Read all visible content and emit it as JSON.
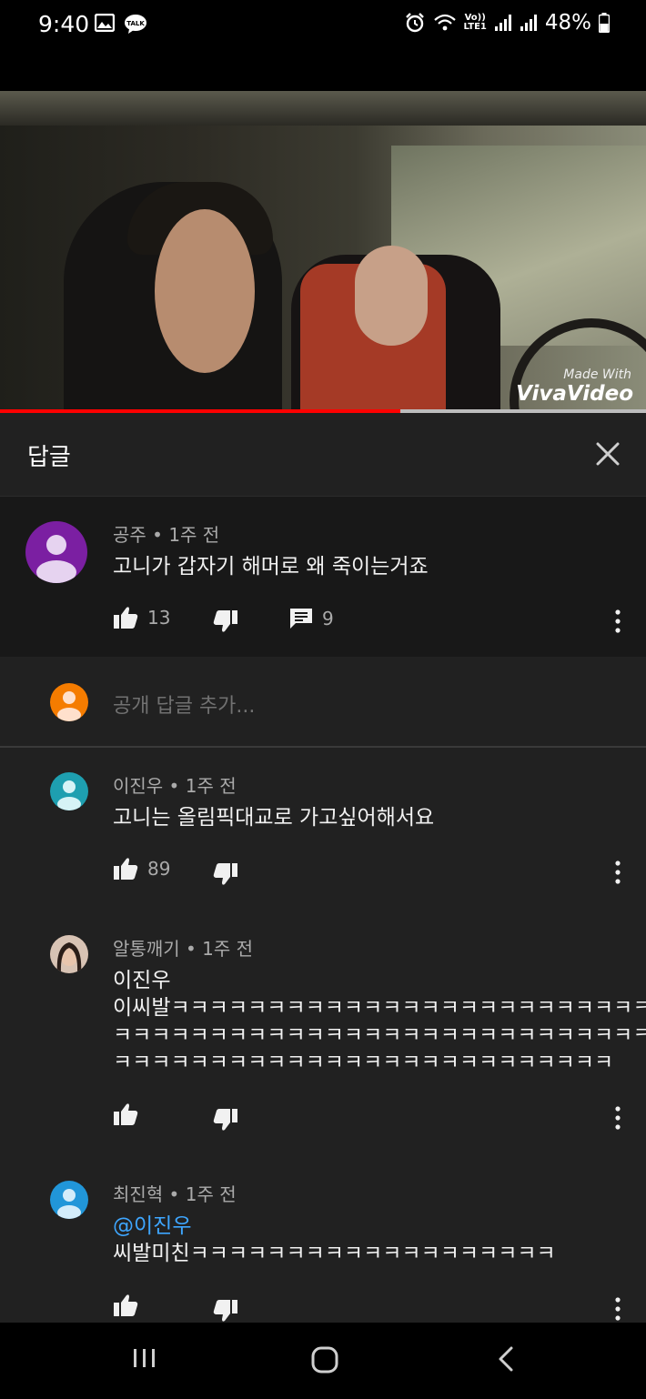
{
  "status_bar": {
    "time": "9:40",
    "lte_top": "Vo))",
    "lte_bottom": "LTE1",
    "battery": "48%",
    "icons": [
      "gallery-icon",
      "kakaotalk-icon",
      "alarm-icon",
      "wifi-icon",
      "signal-icon",
      "signal-icon",
      "battery-icon"
    ]
  },
  "video": {
    "watermark_small": "Made With",
    "watermark_big": "VivaVideo",
    "progress": 0.62,
    "progress_color": "#ff0000"
  },
  "panel": {
    "title": "답글",
    "close_icon": "close-icon"
  },
  "main_comment": {
    "author": "공주",
    "time": "1주 전",
    "text": "고니가 갑자기 해머로 왜 죽이는거죠",
    "likes": "13",
    "replies": "9",
    "avatar_color": "#7b1fa2"
  },
  "reply_input": {
    "placeholder": "공개 답글 추가...",
    "avatar_color": "#f57c00"
  },
  "replies": [
    {
      "author": "이진우",
      "time": "1주 전",
      "lines": [
        "고니는 올림픽대교로 가고싶어해서요"
      ],
      "likes": "89",
      "avatar_color": "#1e9fb0"
    },
    {
      "author": "알통깨기",
      "time": "1주 전",
      "lines": [
        "이진우",
        "이씨발ㅋㅋㅋㅋㅋㅋㅋㅋㅋㅋㅋㅋㅋㅋㅋㅋㅋㅋㅋㅋㅋㅋㅋㅋㅋ",
        "ㅋㅋㅋㅋㅋㅋㅋㅋㅋㅋㅋㅋㅋㅋㅋㅋㅋㅋㅋㅋㅋㅋㅋㅋㅋㅋㅋㅋ",
        "ㅋㅋㅋㅋㅋㅋㅋㅋㅋㅋㅋㅋㅋㅋㅋㅋㅋㅋㅋㅋㅋㅋㅋㅋㅋㅋ"
      ],
      "likes": "",
      "avatar_color": "#5b3a2e"
    },
    {
      "author": "최진혁",
      "time": "1주 전",
      "mention": "@이진우",
      "lines": [
        "씨발미친ㅋㅋㅋㅋㅋㅋㅋㅋㅋㅋㅋㅋㅋㅋㅋㅋㅋㅋㅋ"
      ],
      "likes": "",
      "avatar_color": "#2196d9"
    }
  ],
  "nav": {
    "recents": "recents-icon",
    "home": "home-icon",
    "back": "back-icon"
  }
}
